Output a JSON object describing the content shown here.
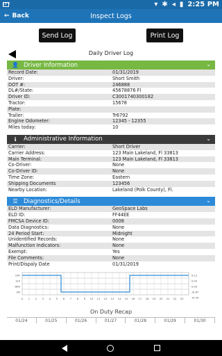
{
  "status_bar": {
    "left_badge": "JIFV",
    "time": "2:25 PM",
    "icons": [
      "notification-icon",
      "wifi-icon",
      "bluetooth-icon",
      "volume-icon",
      "battery-icon"
    ]
  },
  "app_bar": {
    "back_label": "Back",
    "title": "Inspect Logs"
  },
  "buttons": {
    "send": "Send Log",
    "print": "Print Log"
  },
  "nav": {
    "label": "Daily Driver Log"
  },
  "sections": {
    "driver": {
      "title": "Driver Information",
      "rows": [
        {
          "k": "Record Date:",
          "v": "01/31/2019"
        },
        {
          "k": "Driver:",
          "v": "Short Smith"
        },
        {
          "k": "DOT #:",
          "v": "246888"
        },
        {
          "k": "DL#/State:",
          "v": "45678876 Fl"
        },
        {
          "k": "Driver ID:",
          "v": "C3001740300182"
        },
        {
          "k": "Tractor:",
          "v": "15678"
        },
        {
          "k": "Plate:",
          "v": ""
        },
        {
          "k": "Trailer:",
          "v": "Tr6792"
        },
        {
          "k": "Engine Odometer:",
          "v": "12345 - 12355"
        },
        {
          "k": "Miles today:",
          "v": "10"
        }
      ]
    },
    "admin": {
      "title": "Administrative Information",
      "rows": [
        {
          "k": "Carrier:",
          "v": "Short Driver"
        },
        {
          "k": "Carrier Address:",
          "v": "123 Main Lakeland, Fl 33813"
        },
        {
          "k": "Main Terminal:",
          "v": "123 Main Lakeland, Fl 33813"
        },
        {
          "k": "Co-Driver:",
          "v": "None"
        },
        {
          "k": "Co-Driver ID:",
          "v": "None"
        },
        {
          "k": "Time Zone:",
          "v": "Eastern"
        },
        {
          "k": "Shipping Documents",
          "v": "123456"
        },
        {
          "k": "Nearby Location:",
          "v": "Lakeland (Polk County), Fl."
        }
      ]
    },
    "diag": {
      "title": "Diagnostics/Details",
      "rows": [
        {
          "k": "ELD Manufacturer:",
          "v": "GeoSpace Labs"
        },
        {
          "k": "ELD ID:",
          "v": "FF44EE"
        },
        {
          "k": "FMCSA Device ID:",
          "v": "0008"
        },
        {
          "k": "Data Diagnostics:",
          "v": "None"
        },
        {
          "k": "24 Period Start:",
          "v": "Midnight"
        },
        {
          "k": "Unidentified Records:",
          "v": "None"
        },
        {
          "k": "Malfunction Indicators:",
          "v": "None"
        },
        {
          "k": "Exempt:",
          "v": "Yes"
        },
        {
          "k": "File Comments:",
          "v": "None"
        },
        {
          "k": "Print/Dispaly Date",
          "v": "01/31/2019"
        }
      ]
    }
  },
  "graph": {
    "rows": [
      "OFF",
      "SLP",
      "DRV",
      "ON"
    ],
    "totals": [
      "9.13",
      "0.00",
      "0.00",
      "14.87",
      "14.43"
    ],
    "hours": [
      "0",
      "1",
      "2",
      "3",
      "4",
      "5",
      "6",
      "7",
      "8",
      "9",
      "10",
      "11",
      "12",
      "13",
      "14",
      "15",
      "16",
      "17",
      "18",
      "19",
      "20",
      "21",
      "22",
      "23"
    ],
    "segments": [
      {
        "status": "OFF",
        "start": 0,
        "end": 5.6
      },
      {
        "status": "ON",
        "start": 5.6,
        "end": 15.5
      },
      {
        "status": "OFF",
        "start": 15.5,
        "end": 24
      }
    ]
  },
  "recap": {
    "title": "On Duty Recap",
    "dates": [
      "01/24",
      "01/25",
      "01/26",
      "01/27",
      "01/28",
      "01/29",
      "01/30"
    ]
  },
  "accent_colors": {
    "app_bar": "#1f74b8",
    "driver_header": "#77b843",
    "admin_header": "#3a3a3a",
    "diag_header": "#2c8ad8",
    "graph_line": "#2c8ad8"
  }
}
